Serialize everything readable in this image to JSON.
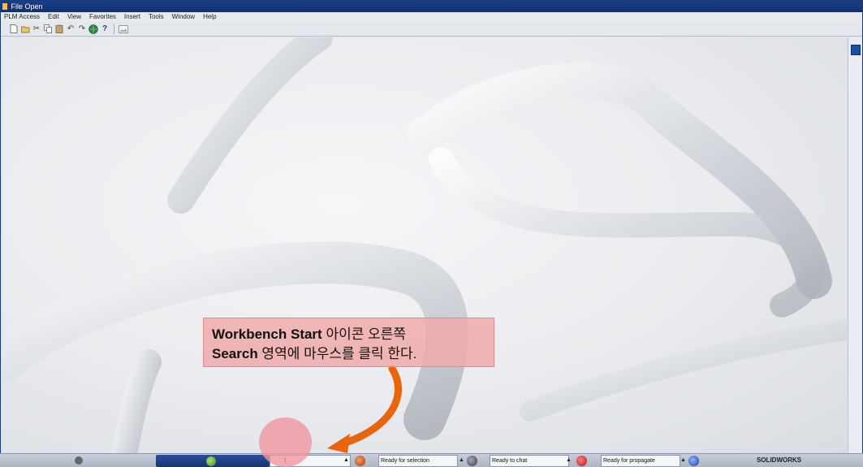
{
  "window": {
    "title": "File Open"
  },
  "menu": {
    "items": [
      "PLM Access",
      "Edit",
      "View",
      "Favorites",
      "Insert",
      "Tools",
      "Window",
      "Help"
    ]
  },
  "toolbar": {
    "icons": [
      "new-document-icon",
      "open-icon",
      "cut-icon",
      "copy-icon",
      "paste-icon",
      "undo-icon",
      "redo-icon",
      "globe-icon",
      "help-icon",
      "image-icon"
    ]
  },
  "callout": {
    "line1_bold": "Workbench Start",
    "line1_rest": " 아이콘 오른쪽",
    "line2_bold": "Search",
    "line2_rest": " 영역에 마우스를 클릭 한다."
  },
  "taskbar": {
    "search_value": "",
    "status_selection": "Ready for selection",
    "status_chat": "Ready to chat",
    "status_propagate": "Ready for propagate",
    "brand": "SOLIDWORKS",
    "colors": {
      "start_bar": "#1f4287",
      "accent": "#e86a10"
    }
  }
}
